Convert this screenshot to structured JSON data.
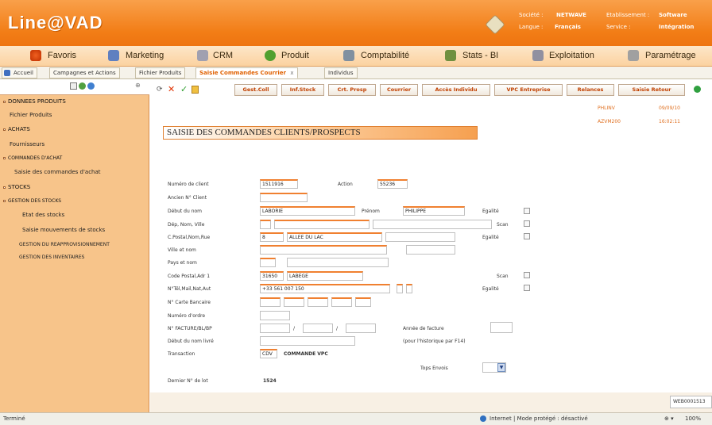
{
  "app": {
    "logo": "Line@VAD",
    "societe_label": "Société :",
    "societe_value": "NETWAVE",
    "langue_label": "Langue :",
    "langue_value": "Français",
    "etab_label": "Etablissement :",
    "etab_value": "Software",
    "service_label": "Service :",
    "service_value": "Intégration"
  },
  "nav": [
    "Favoris",
    "Marketing",
    "CRM",
    "Produit",
    "Comptabilité",
    "Stats - BI",
    "Exploitation",
    "Paramétrage"
  ],
  "tabs": [
    "Accueil",
    "Campagnes et Actions",
    "Fichier Produits",
    "Saisie Commandes Courrier",
    "Individus"
  ],
  "tab_close": "x",
  "sidebar": {
    "items": [
      {
        "label": "DONNEES PRODUITS",
        "type": "header"
      },
      {
        "label": "Fichier Produits",
        "type": "item"
      },
      {
        "label": "ACHATS",
        "type": "header"
      },
      {
        "label": "Fournisseurs",
        "type": "item"
      },
      {
        "label": "COMMANDES D'ACHAT",
        "type": "header"
      },
      {
        "label": "Saisie des commandes d'achat",
        "type": "item"
      },
      {
        "label": "STOCKS",
        "type": "header"
      },
      {
        "label": "GESTION DES STOCKS",
        "type": "header"
      },
      {
        "label": "Etat des stocks",
        "type": "item"
      },
      {
        "label": "Saisie mouvements de stocks",
        "type": "item"
      },
      {
        "label": "GESTION DU REAPPROVISIONNEMENT",
        "type": "item"
      },
      {
        "label": "GESTION DES INVENTAIRES",
        "type": "item"
      }
    ]
  },
  "toolbar": [
    "Gest.Coll",
    "Inf.Stock",
    "Crt. Prosp",
    "Courrier",
    "Accès Individu",
    "VPC Entreprise",
    "Relances",
    "Saisie Retour"
  ],
  "header_info": {
    "user": "PHLINV",
    "date": "09/09/10",
    "program": "AZVM200",
    "time": "16:02:11"
  },
  "form": {
    "title": "SAISIE DES COMMANDES CLIENTS/PROSPECTS",
    "labels": {
      "numero_client": "Numéro de client",
      "action": "Action",
      "ancien_client": "Ancien N° Client",
      "debut_nom": "Début du nom",
      "prenom": "Prénom",
      "egalite": "Egalité",
      "dep_nom_ville": "Dép, Nom, Ville",
      "scan": "Scan",
      "cp_nom_rue": "C.Postal,Nom,Rue",
      "ville_nom": "Ville et nom",
      "pays_nom": "Pays et nom",
      "code_postal_adr": "Code Postal,Adr 1",
      "ntel": "N°Tél,Mail,Nat,Aut",
      "carte": "N° Carte Bancaire",
      "ordre": "Numéro d'ordre",
      "facture": "N° FACTURE/BL/BP",
      "annee_facture": "Année de facture",
      "nom_livre": "Début du nom livré",
      "historique": "(pour l'historique par F14)",
      "transaction": "Transaction",
      "tops_envois": "Tops Envois",
      "dernier_lot": "Dernier N° de lot"
    },
    "values": {
      "numero_client": "1511916",
      "action": "55236",
      "debut_nom": "LABORIE",
      "prenom": "PHILIPPE",
      "cp_num": "8",
      "cp_rue": "ALLEE DU LAC",
      "code_postal": "31650",
      "ville": "LABEGE",
      "tel": "+33 561 007 150",
      "transaction_code": "CDV",
      "transaction_label": "COMMANDE VPC",
      "dernier_lot": "1524",
      "slash": "/"
    }
  },
  "corner_code": "WEB0001513",
  "status": {
    "left": "Terminé",
    "zone": "Internet | Mode protégé : désactivé",
    "zoom": "100%"
  }
}
